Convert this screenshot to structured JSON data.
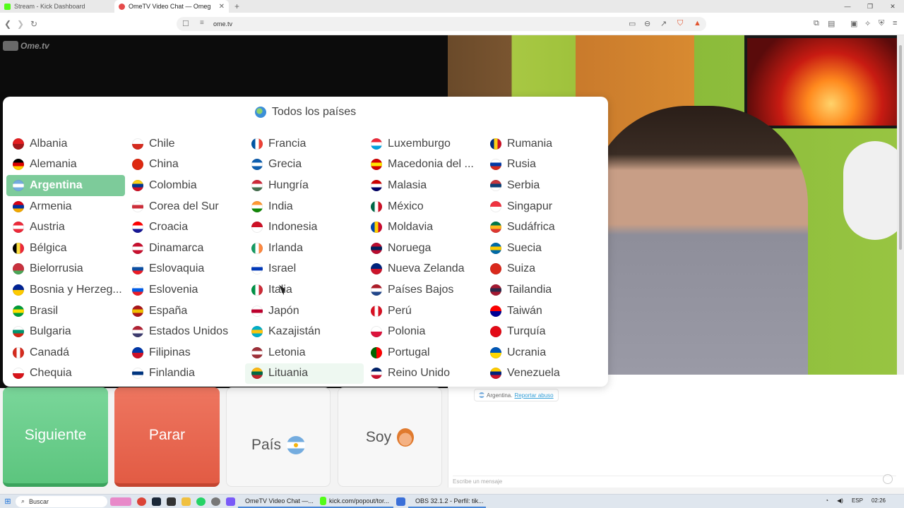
{
  "browser": {
    "tabs": [
      {
        "title": "Stream - Kick Dashboard",
        "active": false,
        "favicon_color": "#53fc18"
      },
      {
        "title": "OmeTV Video Chat — Omeg",
        "active": true,
        "favicon_color": "#e54b4b"
      }
    ],
    "new_tab_symbol": "+",
    "url": "ome.tv",
    "window_controls": [
      "—",
      "❐",
      "✕"
    ]
  },
  "site": {
    "logo_text": "Ome.tv"
  },
  "popup": {
    "title": "Todos los países",
    "columns": [
      [
        {
          "name": "Albania",
          "c": [
            "#e41e20",
            "#a0171a"
          ]
        },
        {
          "name": "Alemania",
          "c": [
            "#000",
            "#dd0000",
            "#ffce00"
          ]
        },
        {
          "name": "Argentina",
          "c": [
            "#74acdf",
            "#fff",
            "#74acdf"
          ],
          "selected": true
        },
        {
          "name": "Armenia",
          "c": [
            "#d90012",
            "#0033a0",
            "#f2a800"
          ]
        },
        {
          "name": "Austria",
          "c": [
            "#ed2939",
            "#fff",
            "#ed2939"
          ]
        },
        {
          "name": "Bélgica",
          "c": [
            "#000",
            "#fae042",
            "#ed2939"
          ],
          "v": true
        },
        {
          "name": "Bielorrusia",
          "c": [
            "#c8313e",
            "#c8313e",
            "#4aa657"
          ]
        },
        {
          "name": "Bosnia y Herzeg...",
          "c": [
            "#002395",
            "#fecb00"
          ]
        },
        {
          "name": "Brasil",
          "c": [
            "#009c3b",
            "#ffdf00",
            "#009c3b"
          ]
        },
        {
          "name": "Bulgaria",
          "c": [
            "#fff",
            "#00966e",
            "#d62612"
          ]
        },
        {
          "name": "Canadá",
          "c": [
            "#d52b1e",
            "#fff",
            "#d52b1e"
          ],
          "v": true
        },
        {
          "name": "Chequia",
          "c": [
            "#fff",
            "#d7141a"
          ]
        }
      ],
      [
        {
          "name": "Chile",
          "c": [
            "#fff",
            "#d52b1e"
          ]
        },
        {
          "name": "China",
          "c": [
            "#de2910",
            "#de2910"
          ]
        },
        {
          "name": "Colombia",
          "c": [
            "#fcd116",
            "#003893",
            "#ce1126"
          ]
        },
        {
          "name": "Corea del Sur",
          "c": [
            "#fff",
            "#cd2e3a",
            "#fff"
          ]
        },
        {
          "name": "Croacia",
          "c": [
            "#ff0000",
            "#fff",
            "#171796"
          ]
        },
        {
          "name": "Dinamarca",
          "c": [
            "#c8102e",
            "#fff",
            "#c8102e"
          ]
        },
        {
          "name": "Eslovaquia",
          "c": [
            "#fff",
            "#0b4ea2",
            "#ee1c25"
          ]
        },
        {
          "name": "Eslovenia",
          "c": [
            "#fff",
            "#005ce6",
            "#ed1c24"
          ]
        },
        {
          "name": "España",
          "c": [
            "#aa151b",
            "#f1bf00",
            "#aa151b"
          ]
        },
        {
          "name": "Estados Unidos",
          "c": [
            "#b22234",
            "#fff",
            "#3c3b6e"
          ]
        },
        {
          "name": "Filipinas",
          "c": [
            "#0038a8",
            "#ce1126"
          ]
        },
        {
          "name": "Finlandia",
          "c": [
            "#fff",
            "#003580",
            "#fff"
          ]
        }
      ],
      [
        {
          "name": "Francia",
          "c": [
            "#0055a4",
            "#fff",
            "#ef4135"
          ],
          "v": true
        },
        {
          "name": "Grecia",
          "c": [
            "#0d5eaf",
            "#fff",
            "#0d5eaf"
          ]
        },
        {
          "name": "Hungría",
          "c": [
            "#ce2939",
            "#fff",
            "#477050"
          ]
        },
        {
          "name": "India",
          "c": [
            "#ff9933",
            "#fff",
            "#138808"
          ]
        },
        {
          "name": "Indonesia",
          "c": [
            "#ce1126",
            "#fff"
          ]
        },
        {
          "name": "Irlanda",
          "c": [
            "#169b62",
            "#fff",
            "#ff883e"
          ],
          "v": true
        },
        {
          "name": "Israel",
          "c": [
            "#fff",
            "#0038b8",
            "#fff"
          ]
        },
        {
          "name": "Italia",
          "c": [
            "#009246",
            "#fff",
            "#ce2b37"
          ],
          "v": true
        },
        {
          "name": "Japón",
          "c": [
            "#fff",
            "#bc002d",
            "#fff"
          ]
        },
        {
          "name": "Kazajistán",
          "c": [
            "#00afca",
            "#fec50c",
            "#00afca"
          ]
        },
        {
          "name": "Letonia",
          "c": [
            "#9e3039",
            "#fff",
            "#9e3039"
          ]
        },
        {
          "name": "Lituania",
          "c": [
            "#fdb913",
            "#006a44",
            "#c1272d"
          ],
          "hover": true
        }
      ],
      [
        {
          "name": "Luxemburgo",
          "c": [
            "#ed2939",
            "#fff",
            "#00a1de"
          ]
        },
        {
          "name": "Macedonia del ...",
          "c": [
            "#d20000",
            "#ffe600",
            "#d20000"
          ]
        },
        {
          "name": "Malasia",
          "c": [
            "#cc0001",
            "#fff",
            "#010066"
          ]
        },
        {
          "name": "México",
          "c": [
            "#006847",
            "#fff",
            "#ce1126"
          ],
          "v": true
        },
        {
          "name": "Moldavia",
          "c": [
            "#0046ae",
            "#ffd200",
            "#cc092f"
          ],
          "v": true
        },
        {
          "name": "Noruega",
          "c": [
            "#ba0c2f",
            "#00205b",
            "#ba0c2f"
          ]
        },
        {
          "name": "Nueva Zelanda",
          "c": [
            "#00247d",
            "#cc142b"
          ]
        },
        {
          "name": "Países Bajos",
          "c": [
            "#ae1c28",
            "#fff",
            "#21468b"
          ]
        },
        {
          "name": "Perú",
          "c": [
            "#d91023",
            "#fff",
            "#d91023"
          ],
          "v": true
        },
        {
          "name": "Polonia",
          "c": [
            "#fff",
            "#dc143c"
          ]
        },
        {
          "name": "Portugal",
          "c": [
            "#006600",
            "#ff0000"
          ],
          "v": true
        },
        {
          "name": "Reino Unido",
          "c": [
            "#012169",
            "#fff",
            "#c8102e"
          ]
        }
      ],
      [
        {
          "name": "Rumania",
          "c": [
            "#002b7f",
            "#fcd116",
            "#ce1126"
          ],
          "v": true
        },
        {
          "name": "Rusia",
          "c": [
            "#fff",
            "#0039a6",
            "#d52b1e"
          ]
        },
        {
          "name": "Serbia",
          "c": [
            "#c6363c",
            "#0c4076",
            "#fff"
          ]
        },
        {
          "name": "Singapur",
          "c": [
            "#ef3340",
            "#fff"
          ]
        },
        {
          "name": "Sudáfrica",
          "c": [
            "#007749",
            "#ffb81c",
            "#de3831"
          ]
        },
        {
          "name": "Suecia",
          "c": [
            "#006aa7",
            "#fecc00",
            "#006aa7"
          ]
        },
        {
          "name": "Suiza",
          "c": [
            "#da291c",
            "#da291c"
          ]
        },
        {
          "name": "Tailandia",
          "c": [
            "#a51931",
            "#2d2a4a",
            "#a51931"
          ]
        },
        {
          "name": "Taiwán",
          "c": [
            "#fe0000",
            "#000095"
          ]
        },
        {
          "name": "Turquía",
          "c": [
            "#e30a17",
            "#e30a17"
          ]
        },
        {
          "name": "Ucrania",
          "c": [
            "#0057b7",
            "#ffd700"
          ]
        },
        {
          "name": "Venezuela",
          "c": [
            "#ffcc00",
            "#00247d",
            "#cf142b"
          ]
        }
      ]
    ]
  },
  "buttons": {
    "next": "Siguiente",
    "stop": "Parar",
    "country": "País",
    "gender": "Soy"
  },
  "chat": {
    "country_label": "Argentina.",
    "report_link": "Reportar abuso",
    "input_placeholder": "Escribe un mensaje"
  },
  "taskbar": {
    "search_label": "Buscar",
    "tasks": [
      "OmeTV Video Chat —...",
      "kick.com/popout/tor...",
      "OBS 32.1.2 - Perfil: tik..."
    ],
    "language": "ESP",
    "time": "02:26"
  }
}
